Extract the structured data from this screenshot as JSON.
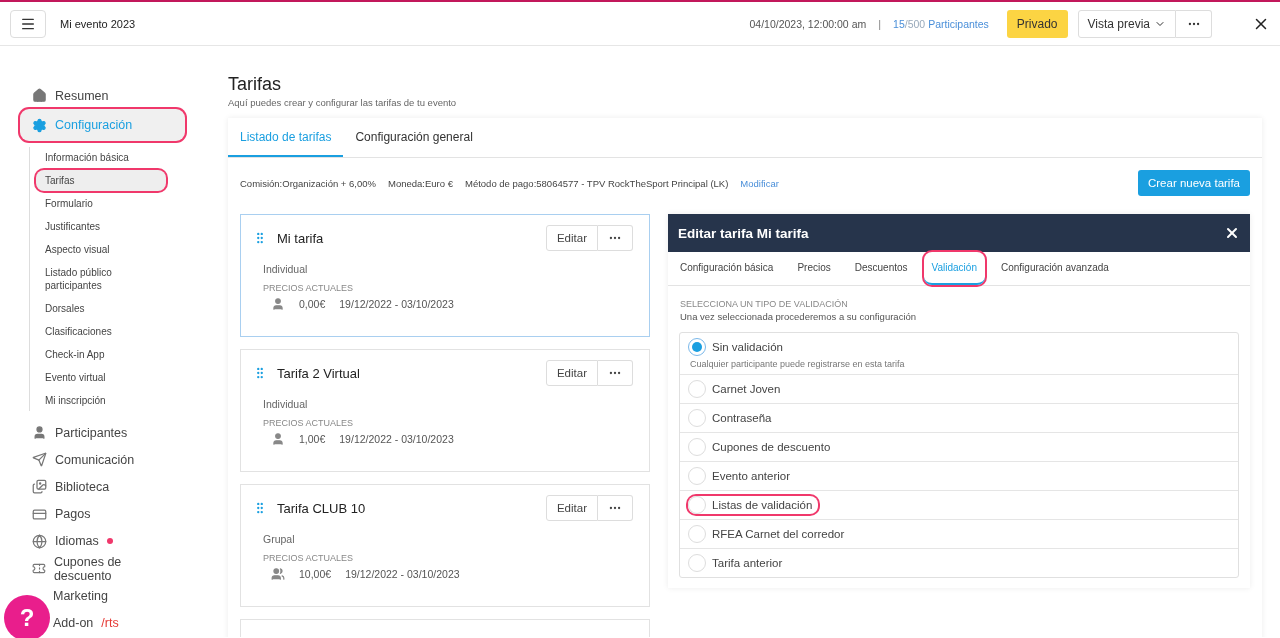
{
  "header": {
    "event_name": "Mi evento 2023",
    "datetime": "04/10/2023, 12:00:00 am",
    "separator": "|",
    "participants_count": "15",
    "participants_total": "/500",
    "participants_label": "Participantes",
    "status_button": "Privado",
    "preview_button": "Vista previa"
  },
  "sidebar": {
    "items": [
      {
        "label": "Resumen",
        "selected": false,
        "highlighted": false
      },
      {
        "label": "Configuración",
        "selected": true,
        "highlighted": true,
        "children": [
          {
            "label": "Información básica",
            "selected": false,
            "highlighted": false
          },
          {
            "label": "Tarifas",
            "selected": true,
            "highlighted": true
          },
          {
            "label": "Formulario",
            "selected": false,
            "highlighted": false
          },
          {
            "label": "Justificantes",
            "selected": false,
            "highlighted": false
          },
          {
            "label": "Aspecto visual",
            "selected": false,
            "highlighted": false
          },
          {
            "label": "Listado público participantes",
            "selected": false,
            "highlighted": false
          },
          {
            "label": "Dorsales",
            "selected": false,
            "highlighted": false
          },
          {
            "label": "Clasificaciones",
            "selected": false,
            "highlighted": false
          },
          {
            "label": "Check-in App",
            "selected": false,
            "highlighted": false
          },
          {
            "label": "Evento virtual",
            "selected": false,
            "highlighted": false
          },
          {
            "label": "Mi inscripción",
            "selected": false,
            "highlighted": false
          }
        ]
      },
      {
        "label": "Participantes",
        "selected": false,
        "highlighted": false
      },
      {
        "label": "Comunicación",
        "selected": false,
        "highlighted": false
      },
      {
        "label": "Biblioteca",
        "selected": false,
        "highlighted": false
      },
      {
        "label": "Pagos",
        "selected": false,
        "highlighted": false
      },
      {
        "label": "Idiomas",
        "selected": false,
        "highlighted": false,
        "alert": true
      },
      {
        "label": "Cupones de descuento",
        "selected": false,
        "highlighted": false
      },
      {
        "label": "Marketing",
        "selected": false,
        "highlighted": false
      },
      {
        "label": "Add-on",
        "suffix": "/rts",
        "selected": false,
        "highlighted": false
      }
    ]
  },
  "help_button": "?",
  "page": {
    "title": "Tarifas",
    "subtitle": "Aquí puedes crear y configurar las tarifas de tu evento",
    "tabs": [
      {
        "label": "Listado de tarifas",
        "selected": true
      },
      {
        "label": "Configuración general",
        "selected": false
      }
    ],
    "info": [
      {
        "label": "Comisión:",
        "value": "Organización + 6,00%"
      },
      {
        "label": "Moneda:",
        "value": "Euro €"
      },
      {
        "label": "Método de pago:",
        "value": "58064577 - TPV RockTheSport Principal (LK)"
      }
    ],
    "modify_link": "Modificar",
    "create_button": "Crear nueva tarifa",
    "rates": [
      {
        "name": "Mi tarifa",
        "selected": true,
        "type": "Individual",
        "prices_label": "PRECIOS ACTUALES",
        "kind": "single",
        "price": "0,00€",
        "dates": "19/12/2022 - 03/10/2023",
        "edit_button": "Editar"
      },
      {
        "name": "Tarifa 2 Virtual",
        "selected": false,
        "type": "Individual",
        "prices_label": "PRECIOS ACTUALES",
        "kind": "single",
        "price": "1,00€",
        "dates": "19/12/2022 - 03/10/2023",
        "edit_button": "Editar"
      },
      {
        "name": "Tarifa CLUB 10",
        "selected": false,
        "type": "Grupal",
        "prices_label": "PRECIOS ACTUALES",
        "kind": "group",
        "price": "10,00€",
        "dates": "19/12/2022 - 03/10/2023",
        "edit_button": "Editar"
      }
    ],
    "editor": {
      "title": "Editar tarifa Mi tarifa",
      "tabs": [
        {
          "label": "Configuración básica",
          "selected": false,
          "highlighted": false
        },
        {
          "label": "Precios",
          "selected": false,
          "highlighted": false
        },
        {
          "label": "Descuentos",
          "selected": false,
          "highlighted": false
        },
        {
          "label": "Validación",
          "selected": true,
          "highlighted": true
        },
        {
          "label": "Configuración avanzada",
          "selected": false,
          "highlighted": false
        }
      ],
      "section_title": "SELECCIONA UN TIPO DE VALIDACIÓN",
      "section_hint": "Una vez seleccionada procederemos a su configuración",
      "options": [
        {
          "label": "Sin validación",
          "description": "Cualquier participante puede registrarse en esta tarifa",
          "selected": true,
          "highlighted": false
        },
        {
          "label": "Carnet Joven",
          "selected": false,
          "highlighted": false
        },
        {
          "label": "Contraseña",
          "selected": false,
          "highlighted": false
        },
        {
          "label": "Cupones de descuento",
          "selected": false,
          "highlighted": false
        },
        {
          "label": "Evento anterior",
          "selected": false,
          "highlighted": false
        },
        {
          "label": "Listas de validación",
          "selected": false,
          "highlighted": true
        },
        {
          "label": "RFEA Carnet del corredor",
          "selected": false,
          "highlighted": false
        },
        {
          "label": "Tarifa anterior",
          "selected": false,
          "highlighted": false
        }
      ]
    }
  }
}
